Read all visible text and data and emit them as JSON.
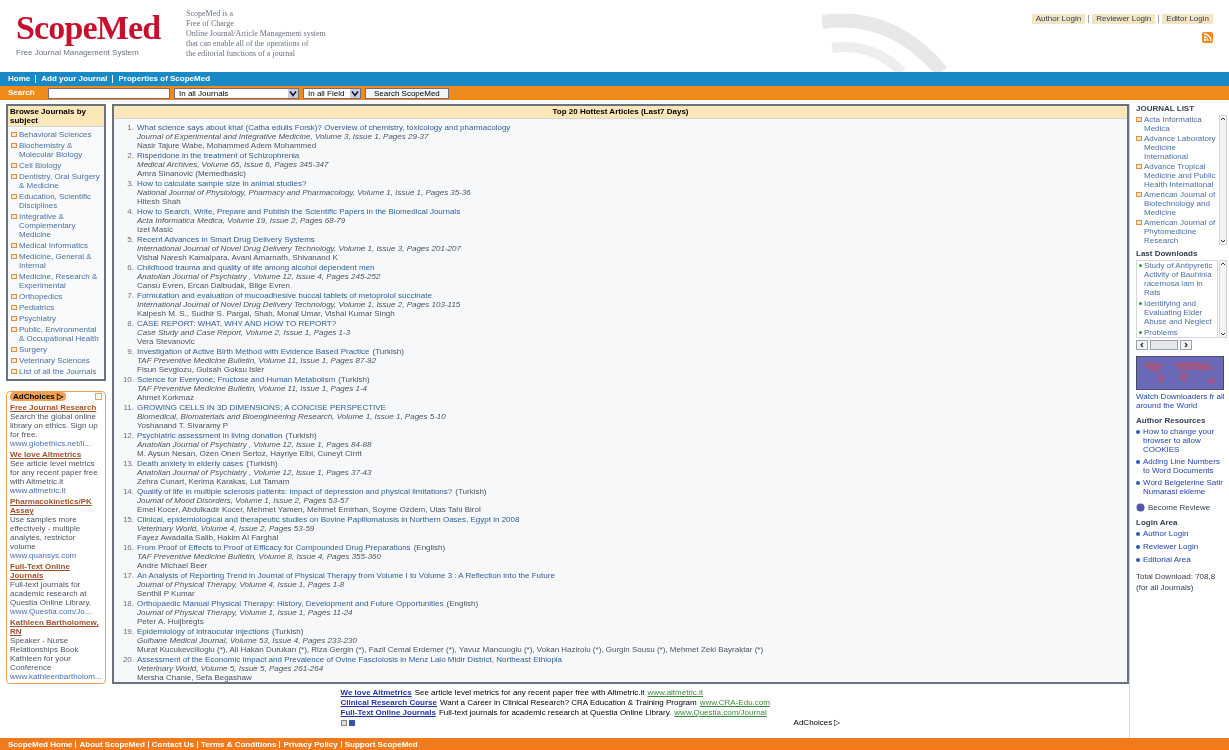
{
  "header": {
    "logo": "ScopeMed",
    "logo_subtitle": "Free Journal Management System",
    "tagline": [
      "ScopeMed is a",
      "Free of Charge",
      "Online Journal/Article Management system",
      "that can enable all of the operations of",
      "the editorial functions of a journal"
    ],
    "top_links": [
      "Author Login",
      "Reviewer Login",
      "Editor Login"
    ]
  },
  "nav": [
    "Home",
    "Add your Journal",
    "Properties of ScopeMed"
  ],
  "search": {
    "label": "Search",
    "journal_select": "In all Journals",
    "field_select": "In all Field",
    "button": "Search ScopeMed"
  },
  "subjects": {
    "title": "Browse Journals by subject",
    "items": [
      "Behavioral Sciences",
      "Biochemistry & Molecular Biology",
      "Cell Biology",
      "Dentistry, Oral Surgery & Medicine",
      "Education, Scientific Disciplines",
      "Integrative & Complementary Medicine",
      "Medical Informatics",
      "Medicine, General & Internal",
      "Medicine, Research & Experimental",
      "Orthopedics",
      "Pediatrics",
      "Psychiatry",
      "Public, Environmental & Occupational Health",
      "Surgery",
      "Veterinary Sciences",
      "List of all the Journals"
    ]
  },
  "side_ads": {
    "badge": "AdChoices ▷",
    "items": [
      {
        "title": "Free Journal Research",
        "text": "Search the global online library on ethics. Sign up for free.",
        "url": "www.globethics.net/li..."
      },
      {
        "title": "We love Altmetrics",
        "text": "See article level metrics for any recent paper free with Altmetric.it",
        "url": "www.altmetric.it"
      },
      {
        "title": "Pharmacokinetics/PK Assay",
        "text": "Use samples more effectively - multiple analytes, restrictor volume",
        "url": "www.quansys.com"
      },
      {
        "title": "Full-Text Online Journals",
        "text": "Full-text journals for academic research at Questia Online Library.",
        "url": "www.Questia.com/Jo..."
      },
      {
        "title": "Kathleen Bartholomew, RN",
        "text": "Speaker - Nurse Relationships Book Kathleen for your Conference",
        "url": "www.kathleenbartholom..."
      }
    ]
  },
  "main": {
    "title": "Top 20 Hottest Articles (Last7 Days)",
    "articles": [
      {
        "number": "1.",
        "title": "What science says about khat (Catha edulis Forsk)? Overview of chemistry, toxicology and pharmacology",
        "journal": "Journal of Experimental and Integrative Medicine, Volume 3, Issue 1, Pages 29-37",
        "authors": "Nasir Tajure Wabe, Mohammed Adem Mohammed"
      },
      {
        "number": "2.",
        "title": "Risperidone in the treatment of Schizophrenia",
        "journal": "Medical Archives, Volume 65, Issue 6, Pages 345-347",
        "authors": "Amra Sinanovic (Memedbasic)"
      },
      {
        "number": "3.",
        "title": "How to calculate sample size in animal studies?",
        "journal": "National Journal of Physiology, Pharmacy and Pharmacology, Volume 1, Issue 1, Pages 35-36",
        "authors": "Hitesh Shah"
      },
      {
        "number": "4.",
        "title": "How to Search, Write, Prepare and Publish the Scientific Papers in the Biomedical Journals",
        "journal": "Acta Informatica Medica, Volume 19, Issue 2, Pages 68-79",
        "authors": "Izet Masic"
      },
      {
        "number": "5.",
        "title": "Recent Advances in Smart Drug Delivery Systems",
        "journal": "International Journal of Novel Drug Delivery Technology, Volume 1, Issue 3, Pages 201-207",
        "authors": "Vishal Naresh Kamalpara, Avani Amarnath, Shivanand K"
      },
      {
        "number": "6.",
        "title": "Childhood trauma and quality of life among alcohol dependent men",
        "journal": "Anatolian Journal of Psychiatry , Volume 12, Issue 4, Pages 245-252",
        "authors": "Cansu Evren, Ercan Dalbudak, Bilge Evren"
      },
      {
        "number": "7.",
        "title": "Formulation and evaluation of mucoadhesive buccal tablets of metoprolol succinate",
        "journal": "International Journal of Novel Drug Delivery Technology, Volume 1, Issue 2, Pages 103-115",
        "authors": "Kalpesh M. S., Sudhir S. Pargai, Shah, Monal Umar, Vishal Kumar Singh"
      },
      {
        "number": "8.",
        "title": "CASE REPORT: WHAT, WHY AND HOW TO REPORT?",
        "journal": "Case Study and Case Report, Volume 2, Issue 1, Pages 1-3",
        "authors": "Vera Stevanovic"
      },
      {
        "number": "9.",
        "title": "Investigation of Active Birth Method with Evidence Based Practice",
        "lang": "(Turkish)",
        "journal": "TAF Preventive Medicine Bulletin, Volume 11, Issue 1, Pages 87-92",
        "authors": "Fisun Sevgiozu, Gulsah Goksu Isler"
      },
      {
        "number": "10.",
        "title": "Science for Everyone; Fructose and Human Metabolism",
        "lang": "(Turkish)",
        "journal": "TAF Preventive Medicine Bulletin, Volume 11, Issue 1, Pages 1-4",
        "authors": "Ahmet Korkmaz"
      },
      {
        "number": "11.",
        "title": "GROWING CELLS IN 3D DIMENSIONS; A CONCISE PERSPECTIVE",
        "journal": "Biomedical, Biomaterials and Bioengineering Research, Volume 1, Issue 1, Pages 5-10",
        "authors": "Yoshanand T. Sivaramy P"
      },
      {
        "number": "12.",
        "title": "Psychiatric assessment in living donation",
        "lang": "(Turkish)",
        "journal": "Anatolian Journal of Psychiatry , Volume 12, Issue 1, Pages 84-88",
        "authors": "M. Aysun Nesan, Ozen Onen Sertoz, Hayriye Elbi, Cuneyt Cirrit"
      },
      {
        "number": "13.",
        "title": "Death anxiety in elderly cases",
        "lang": "(Turkish)",
        "journal": "Anatolian Journal of Psychiatry , Volume 12, Issue 1, Pages 37-43",
        "authors": "Zehra Cunart, Kerima Karakas, Lut Tamam"
      },
      {
        "number": "14.",
        "title": "Quality of life in multiple sclerosis patients: impact of depression and physical limitations?",
        "lang": "(Turkish)",
        "journal": "Journal of Mood Disorders, Volume 1, Issue 2, Pages 53-57",
        "authors": "Emel Kocer, Abdulkadir Kocer, Mehmet Yamen, Mehmet Emirhan, Soyme Ozdem, Ulas Tahi Birol"
      },
      {
        "number": "15.",
        "title": "Clinical, epidemiological and therapeutic studies on Bovine Papillomatosis in Northern Oases, Egypt in 2008",
        "journal": "Veterinary World, Volume 4, Issue 2, Pages 53-59",
        "authors": "Fayez Awadalla Salib, Hakim Al Farghal"
      },
      {
        "number": "16.",
        "title": "From Proof of Effects to Proof of Efficacy for Compounded Drug Preparations",
        "lang": "(English)",
        "journal": "TAF Preventive Medicine Bulletin, Volume 8, Issue 4, Pages 355-360",
        "authors": "Andre Michael Beer"
      },
      {
        "number": "17.",
        "title": "An Analysis of Reporting Trend in Journal of Physical Therapy from Volume I to Volume 3 : A Reflection into the Future",
        "journal": "Journal of Physical Therapy, Volume 4, Issue 1, Pages 1-8",
        "authors": "Senthil P Kumar"
      },
      {
        "number": "18.",
        "title": "Orthopaedic Manual Physical Therapy: History, Development and Future Opportunities",
        "lang": "(English)",
        "journal": "Journal of Physical Therapy, Volume 1, Issue 1, Pages 11-24",
        "authors": "Peter A. Huijbregts"
      },
      {
        "number": "19.",
        "title": "Epidemiology of intraocular injections",
        "lang": "(Turkish)",
        "journal": "Gulhane Medical Journal, Volume 53, Issue 4, Pages 233-230",
        "authors": "Murat Kucukevcilioglu (*), Ali Hakan Durukan (*), Riza Gergin (*), Fazil Cemal Erdemer (*), Yavuz Mancuoglu (*), Vokan Hazirolu (*), Gurgin Sousu (*), Mehmet Zeki Bayraktar (*)"
      },
      {
        "number": "20.",
        "title": "Assessment of the Economic Impact and Prevalence of Ovine Fasciolosis in Menz Lalo Midir District, Northeast Ethiopia",
        "journal": "Veterinary World, Volume 5, Issue 5, Pages 261-264",
        "authors": "Mersha Chanie, Sefa Begashaw"
      }
    ]
  },
  "right": {
    "journal_list": {
      "title": "JOURNAL LIST",
      "items": [
        "Acta Informatica Medica",
        "Advance Laboratory Medicine International",
        "Advance Tropical Medicine and Public Health International",
        "American Journal of Biotechnology and Medicine",
        "American Journal of Phytomedicine Research"
      ]
    },
    "last_downloads": {
      "title": "Last Downloads",
      "items": [
        "Study of Antipyretic Activity of Bauhinia racemosa lam in Rats",
        "Identifying and Evaluating Elder Abuse and Neglect",
        "Problems"
      ]
    },
    "map_caption": "Watch Downloaders fr all around the World",
    "author_resources": {
      "title": "Author Resources",
      "items": [
        "How to change your browser to allow COOKIES",
        "Adding Line Numbers to Word Documents",
        "Word Belgelerine Satir Numarasi ekleme"
      ]
    },
    "become_reviewer": "Become Reviewe",
    "login_area": {
      "title": "Login Area",
      "items": [
        "Author Login",
        "Reviewer Login",
        "Editorial Area"
      ]
    },
    "total_download": "Total Download: 708,8",
    "total_note": "(for all Journals)"
  },
  "bottom_ads": {
    "items": [
      {
        "title": "We love Altmetrics",
        "text": "See article level metrics for any recent paper free with Altmetric.it",
        "url": "www.altmetric.it"
      },
      {
        "title": "Clinical Research Course",
        "text": "Want a Career in Clinical Research? CRA Education & Training Program",
        "url": "www.CRA-Edu.com"
      },
      {
        "title": "Full-Text Online Journals",
        "text": "Full-text journals for academic research at Questia Online Library.",
        "url": "www.Questia.com/Journal"
      }
    ],
    "badge": "AdChoices ▷"
  },
  "footer_links": [
    "ScopeMed Home",
    "About ScopeMed",
    "Contact Us",
    "Terms & Conditions",
    "Privacy Policy",
    "Support ScopeMed"
  ]
}
